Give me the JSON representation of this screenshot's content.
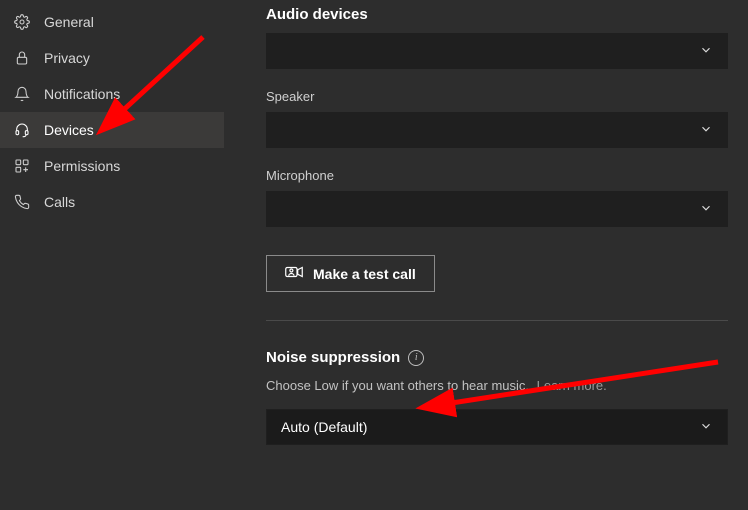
{
  "sidebar": {
    "items": [
      {
        "label": "General",
        "icon": "gear-icon",
        "active": false
      },
      {
        "label": "Privacy",
        "icon": "lock-icon",
        "active": false
      },
      {
        "label": "Notifications",
        "icon": "bell-icon",
        "active": false
      },
      {
        "label": "Devices",
        "icon": "headset-icon",
        "active": true
      },
      {
        "label": "Permissions",
        "icon": "apps-icon",
        "active": false
      },
      {
        "label": "Calls",
        "icon": "phone-icon",
        "active": false
      }
    ]
  },
  "main": {
    "audio_devices_title": "Audio devices",
    "audio_devices_value": "",
    "speaker_label": "Speaker",
    "speaker_value": "",
    "microphone_label": "Microphone",
    "microphone_value": "",
    "test_call_label": "Make a test call",
    "noise_title": "Noise suppression",
    "noise_help": "Choose Low if you want others to hear music.",
    "learn_more": "Learn more.",
    "noise_value": "Auto (Default)"
  },
  "colors": {
    "bg": "#2d2d2d",
    "panel": "#1f1f1f",
    "active": "#3b3a39",
    "arrow": "#ff0000"
  }
}
